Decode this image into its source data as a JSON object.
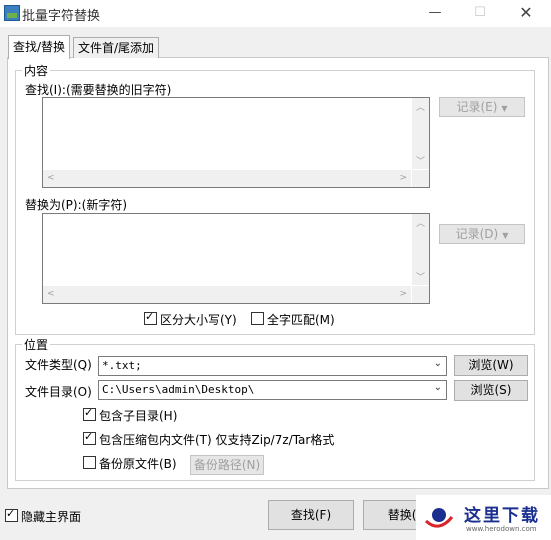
{
  "window": {
    "title": "批量字符替换",
    "min_glyph": "—",
    "max_glyph": "☐",
    "close_glyph": "✕"
  },
  "tabs": [
    {
      "label": "查找/替换",
      "active": true
    },
    {
      "label": "文件首/尾添加",
      "active": false
    }
  ],
  "content_group": {
    "title": "内容",
    "find_label": "查找(I):(需要替换的旧字符)",
    "find_value": "",
    "find_history_button": "记录(E)",
    "replace_label": "替换为(P):(新字符)",
    "replace_value": "",
    "replace_history_button": "记录(D)",
    "case_sensitive": {
      "label": "区分大小写(Y)",
      "checked": true
    },
    "whole_word": {
      "label": "全字匹配(M)",
      "checked": false
    }
  },
  "position_group": {
    "title": "位置",
    "file_type_label": "文件类型(Q)",
    "file_type_value": "*.txt;",
    "file_type_browse": "浏览(W)",
    "dir_label": "文件目录(O)",
    "dir_value": "C:\\Users\\admin\\Desktop\\",
    "dir_browse": "浏览(S)",
    "include_subdirs": {
      "label": "包含子目录(H)",
      "checked": true
    },
    "include_archives": {
      "label": "包含压缩包内文件(T) 仅支持Zip/7z/Tar格式",
      "checked": true
    },
    "backup": {
      "label": "备份原文件(B)",
      "checked": false
    },
    "backup_path_button": "备份路径(N)"
  },
  "footer": {
    "hide_main": {
      "label": "隐藏主界面",
      "checked": true
    },
    "find_button": "查找(F)",
    "replace_button": "替换(K"
  },
  "watermark": {
    "text": "这里下载",
    "url": "www.herodown.com"
  },
  "colors": {
    "watermark_text": "#1a2f8f",
    "watermark_red": "#d6262b"
  }
}
